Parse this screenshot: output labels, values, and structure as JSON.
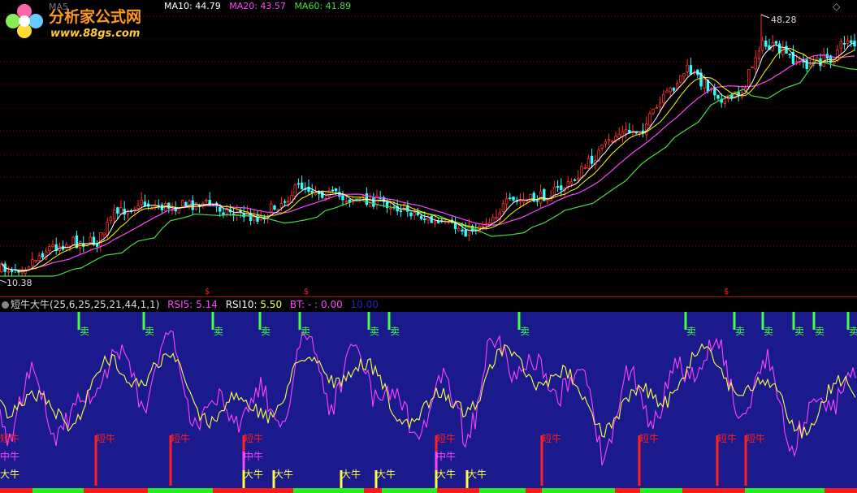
{
  "watermark": {
    "title": "分析家公式网",
    "url": "www.88gs.com"
  },
  "main_chart": {
    "partial_header_text": "MA5",
    "ma_legend": [
      {
        "label": "MA10:",
        "value": "44.79",
        "color": "#ffffff"
      },
      {
        "label": "MA20:",
        "value": "43.57",
        "color": "#ff44ff"
      },
      {
        "label": "MA60:",
        "value": "41.89",
        "color": "#44dd44"
      }
    ],
    "high_marker": "48.28",
    "low_marker": "10.38",
    "corner_glyph": "◇",
    "colors": {
      "up": "#ff3030",
      "down": "#30ffff",
      "grid": "#8b0000",
      "ma5": "#ffffff",
      "ma10": "#ffff00",
      "ma20": "#ff44ff",
      "ma60": "#44dd44"
    }
  },
  "indicator": {
    "name": "短牛大牛",
    "params": "(25,6,25,25,21,44,1,1)",
    "rsi5_label": "RSI5:",
    "rsi5_value": "5.14",
    "rsi10_label": "RSI10:",
    "rsi10_value": "5.50",
    "bt_label": "BT:",
    "bt_value": "- : 0.00",
    "extra_value": "10.00",
    "sell_label": "卖",
    "short_bull_label": "短牛",
    "mid_bull_label": "中牛",
    "big_bull_label": "大牛",
    "colors": {
      "bg": "#1a1a8c",
      "rsi5": "#ff44ff",
      "rsi10": "#ffff00",
      "sell": "#44ff44",
      "short": "#ff2020",
      "mid": "#ff44ff",
      "big": "#ffff44"
    }
  },
  "chart_data": {
    "type": "line",
    "title": "",
    "xlabel": "",
    "ylabel": "",
    "y_marks": {
      "high": 48.28,
      "low": 10.38
    },
    "sell_signal_positions_x": [
      100,
      180,
      265,
      323,
      372,
      457,
      482,
      642,
      847,
      907,
      942,
      980,
      1005,
      1047
    ],
    "short_bull_positions_x": [
      0,
      118,
      210,
      300,
      537,
      667,
      787,
      883,
      918
    ],
    "mid_bull_positions_x": [
      0,
      300,
      537
    ],
    "big_bull_positions_x": [
      0,
      300,
      337,
      420,
      463,
      537,
      575
    ]
  }
}
